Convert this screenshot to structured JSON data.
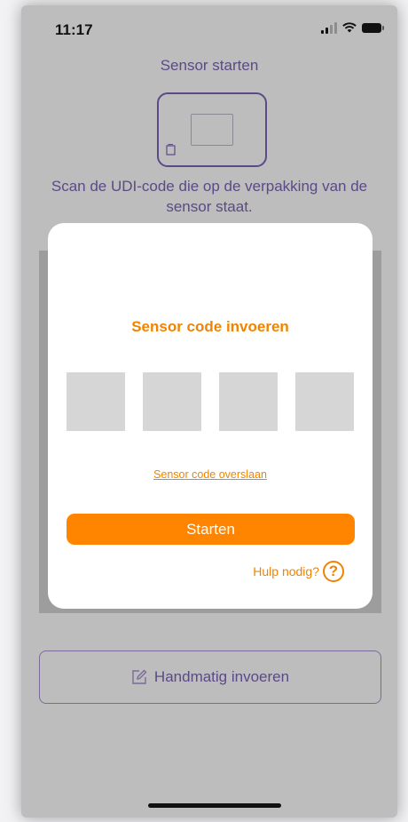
{
  "status_bar": {
    "time": "11:17"
  },
  "header": {
    "title": "Sensor starten"
  },
  "instruction": {
    "text": "Scan de UDI-code die op de verpakking van de sensor staat."
  },
  "manual_entry": {
    "label": "Handmatig invoeren",
    "icon": "edit-icon"
  },
  "modal": {
    "title": "Sensor code invoeren",
    "code_fields": [
      "",
      "",
      "",
      ""
    ],
    "skip_link": "Sensor code overslaan",
    "start_button": "Starten",
    "help_label": "Hulp nodig?",
    "help_icon_glyph": "?"
  },
  "colors": {
    "accent_orange": "#ff8400",
    "header_purple": "#5b4a86",
    "overlay_grey": "#bdbdbd"
  }
}
